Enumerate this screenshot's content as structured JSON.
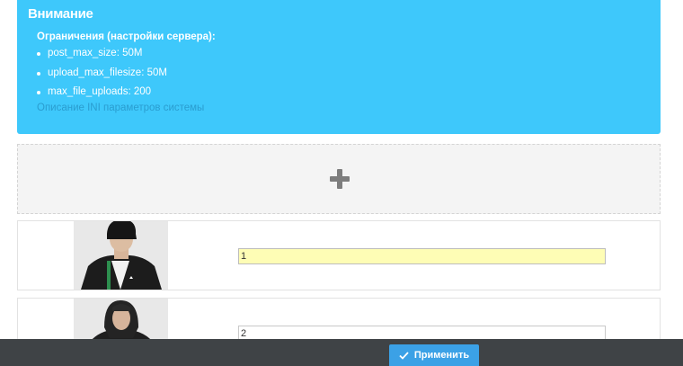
{
  "alert": {
    "title": "Внимание",
    "subtitle": "Ограничения (настройки сервера):",
    "limits": [
      "post_max_size: 50M",
      "upload_max_filesize: 50M",
      "max_file_uploads: 200"
    ],
    "link_text": "Описание INI параметров системы",
    "color": "#3ec8fb"
  },
  "dropzone": {
    "icon": "plus-icon"
  },
  "files": [
    {
      "order": "1",
      "thumbnail": "person-in-black-jacket-and-beanie"
    },
    {
      "order": "2",
      "thumbnail": "person-in-black-hoodie"
    }
  ],
  "footer": {
    "apply_label": "Применить",
    "apply_icon": "check-icon",
    "button_color": "#3ba1e6"
  }
}
